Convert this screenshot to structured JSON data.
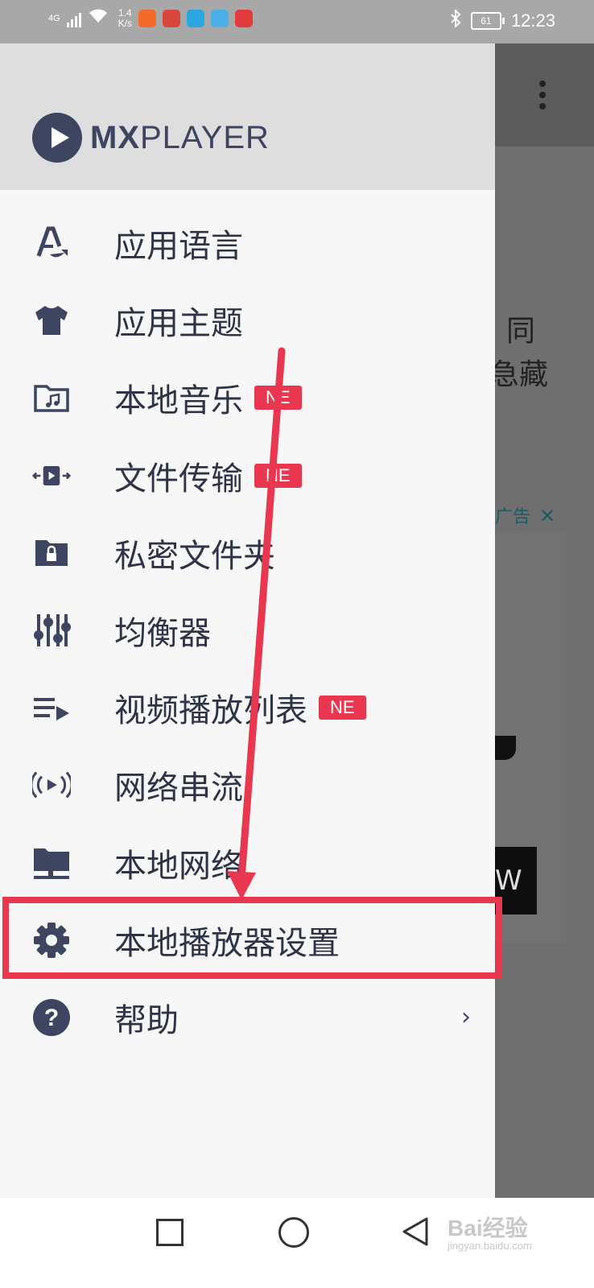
{
  "status_bar": {
    "network": "4G",
    "speed_value": "1.4",
    "speed_unit": "K/s",
    "battery": "61",
    "time": "12:23",
    "app_icon_colors": [
      "#f26b2a",
      "#d9463e",
      "#2aa6e0",
      "#4ab0e6",
      "#e23b3b"
    ]
  },
  "drawer": {
    "logo_bold": "MX",
    "logo_light": "PLAYER",
    "items": [
      {
        "label": "应用语言",
        "icon": "language-icon",
        "badge": ""
      },
      {
        "label": "应用主题",
        "icon": "tshirt-theme-icon",
        "badge": ""
      },
      {
        "label": "本地音乐",
        "icon": "music-folder-icon",
        "badge": "NE"
      },
      {
        "label": "文件传输",
        "icon": "file-transfer-icon",
        "badge": "NE"
      },
      {
        "label": "私密文件夹",
        "icon": "locked-folder-icon",
        "badge": ""
      },
      {
        "label": "均衡器",
        "icon": "equalizer-icon",
        "badge": ""
      },
      {
        "label": "视频播放列表",
        "icon": "playlist-icon",
        "badge": "NE"
      },
      {
        "label": "网络串流",
        "icon": "stream-icon",
        "badge": ""
      },
      {
        "label": "本地网络",
        "icon": "local-network-icon",
        "badge": ""
      },
      {
        "label": "本地播放器设置",
        "icon": "gear-icon",
        "badge": ""
      },
      {
        "label": "帮助",
        "icon": "help-icon",
        "badge": ""
      }
    ],
    "help_chevron": "›"
  },
  "background_app": {
    "text_line1": "同",
    "text_line2": "急藏",
    "ad_label": "广告",
    "ad_close": "✕",
    "button_text": "W"
  },
  "watermark": {
    "brand": "Bai经验",
    "site": "jingyan.baidu.com"
  },
  "colors": {
    "accent_red": "#e8374f",
    "icon_navy": "#3d4561",
    "drawer_bg": "#f7f7f7",
    "header_bg": "#dedede"
  }
}
